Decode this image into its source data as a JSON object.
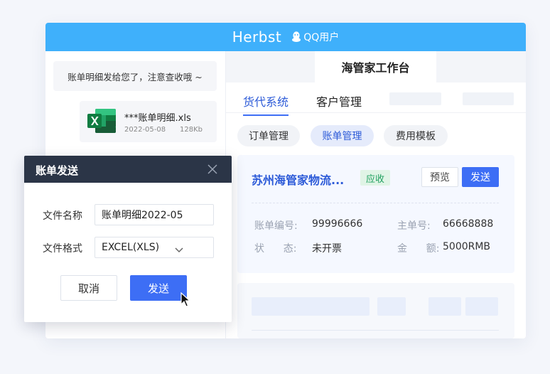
{
  "app": {
    "title": "Herbst",
    "account_label": "QQ用户",
    "icons": {
      "account": "qq-penguin-icon",
      "file": "excel-icon",
      "close": "close-icon",
      "select": "chevron-down-icon",
      "pointer": "mouse-cursor-icon"
    },
    "colors": {
      "topbar": "#3fb0fb",
      "accent": "#3d6ef5",
      "dialog_header": "#2b3547",
      "status_green": "#21a060"
    }
  },
  "chat": {
    "message": "账单明细发给您了，注意查收哦 ~",
    "file": {
      "name": "***账单明细.xls",
      "date": "2022-05-08",
      "size": "128Kb"
    }
  },
  "workspace": {
    "title": "海管家工作台",
    "tabs": [
      {
        "label": "货代系统",
        "active": true
      },
      {
        "label": "客户管理",
        "active": false
      }
    ],
    "sub_tabs": [
      {
        "label": "订单管理",
        "active": false
      },
      {
        "label": "账单管理",
        "active": true
      },
      {
        "label": "费用模板",
        "active": false
      }
    ],
    "bill": {
      "company": "苏州海管家物流...",
      "status_tag": "应收",
      "preview_label": "预览",
      "send_label": "发送",
      "fields": {
        "bill_no": {
          "label": "账单编号:",
          "value": "99996666"
        },
        "master_no": {
          "label": "主单号:",
          "value": "66668888"
        },
        "status": {
          "label": "状      态:",
          "value": "未开票"
        },
        "amount": {
          "label": "金      额:",
          "value": "5000RMB"
        }
      }
    }
  },
  "dialog": {
    "title": "账单发送",
    "file_name_label": "文件名称",
    "file_name_value": "账单明细2022-05",
    "file_format_label": "文件格式",
    "file_format_value": "EXCEL(XLS)",
    "cancel_label": "取消",
    "send_label": "发送"
  }
}
